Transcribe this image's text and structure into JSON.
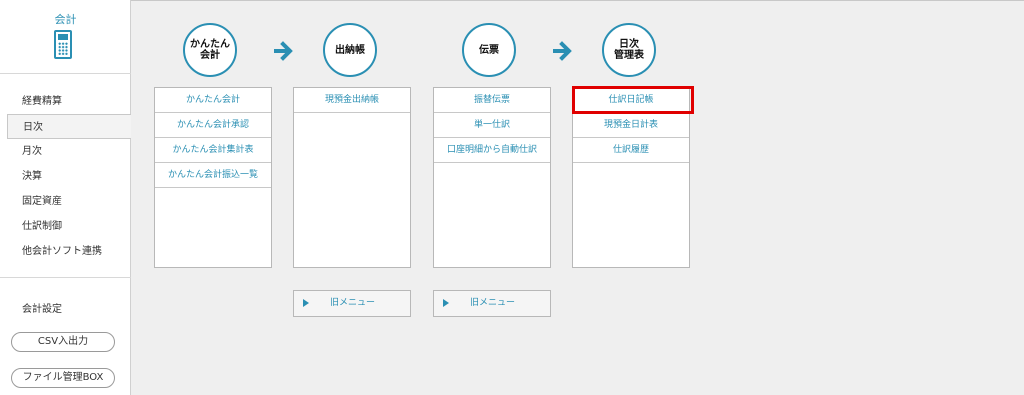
{
  "sidebar": {
    "title": "会計",
    "icon": "calculator-icon",
    "nav": [
      {
        "label": "経費精算"
      },
      {
        "label": "日次",
        "active": true
      },
      {
        "label": "月次"
      },
      {
        "label": "決算"
      },
      {
        "label": "固定資産"
      },
      {
        "label": "仕訳制御"
      },
      {
        "label": "他会計ソフト連携"
      }
    ],
    "settings_label": "会計設定",
    "csv_button": "CSV入出力",
    "file_button": "ファイル管理BOX"
  },
  "steps": [
    {
      "circle": "かんたん\n会計",
      "items": [
        "かんたん会計",
        "かんたん会計承認",
        "かんたん会計集計表",
        "かんたん会計振込一覧"
      ]
    },
    {
      "circle": "出納帳",
      "items": [
        "現預金出納帳"
      ],
      "old_menu": "旧メニュー"
    },
    {
      "circle": "伝票",
      "items": [
        "振替伝票",
        "単一仕訳",
        "口座明細から自動仕訳"
      ],
      "old_menu": "旧メニュー"
    },
    {
      "circle": "日次\n管理表",
      "items": [
        "仕訳日記帳",
        "現預金日計表",
        "仕訳履歴"
      ],
      "highlighted": "仕訳日記帳"
    }
  ],
  "colors": {
    "accent": "#2a8fb3",
    "highlight": "#e00000"
  }
}
